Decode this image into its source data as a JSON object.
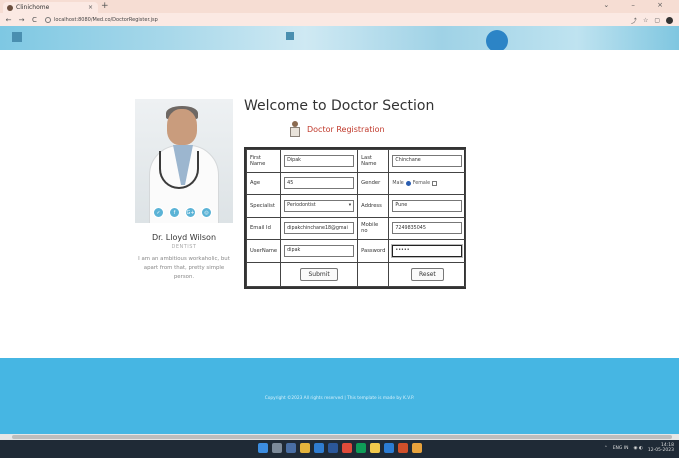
{
  "browser": {
    "tab_title": "Clinichome",
    "tab_close": "×",
    "new_tab": "+",
    "window_controls": "⌄ – ×",
    "url": "localhost:8080/Med.co/DoctorRegister.jsp",
    "nav": {
      "back": "←",
      "forward": "→",
      "reload": "C"
    }
  },
  "profile": {
    "name": "Dr. Lloyd Wilson",
    "role": "DENTIST",
    "bio": "I am an ambitious workaholic, but apart from that, pretty simple person.",
    "social": [
      "✓",
      "f",
      "G+",
      "◎"
    ]
  },
  "page": {
    "heading": "Welcome to Doctor Section",
    "form_title": "Doctor Registration"
  },
  "form": {
    "first_name_label": "First Name",
    "first_name_value": "Dipak",
    "last_name_label": "Last Name",
    "last_name_value": "Chinchane",
    "age_label": "Age",
    "age_value": "45",
    "gender_label": "Gender",
    "gender_male": "Male",
    "gender_female": "Female",
    "specialist_label": "Specialist",
    "specialist_value": "Periodontist",
    "address_label": "Address",
    "address_value": "Pune",
    "email_label": "Email Id",
    "email_value": "dipakchinchane18@gmai",
    "mobile_label": "Mobile no",
    "mobile_value": "7249835045",
    "username_label": "UserName",
    "username_value": "dipak",
    "password_label": "Password",
    "password_value": "•••••",
    "submit_label": "Submit",
    "reset_label": "Reset"
  },
  "footer": {
    "copyright": "Copyright ©2023 All rights reserved | This template is made by K.V.P."
  },
  "taskbar": {
    "tray_lang": "ENG IN",
    "time": "14:18",
    "date": "12-05-2023"
  },
  "colors": {
    "footer_bg": "#46b6e3",
    "registration_title": "#c0392b",
    "taskbar_bg": "#1f2a36"
  }
}
